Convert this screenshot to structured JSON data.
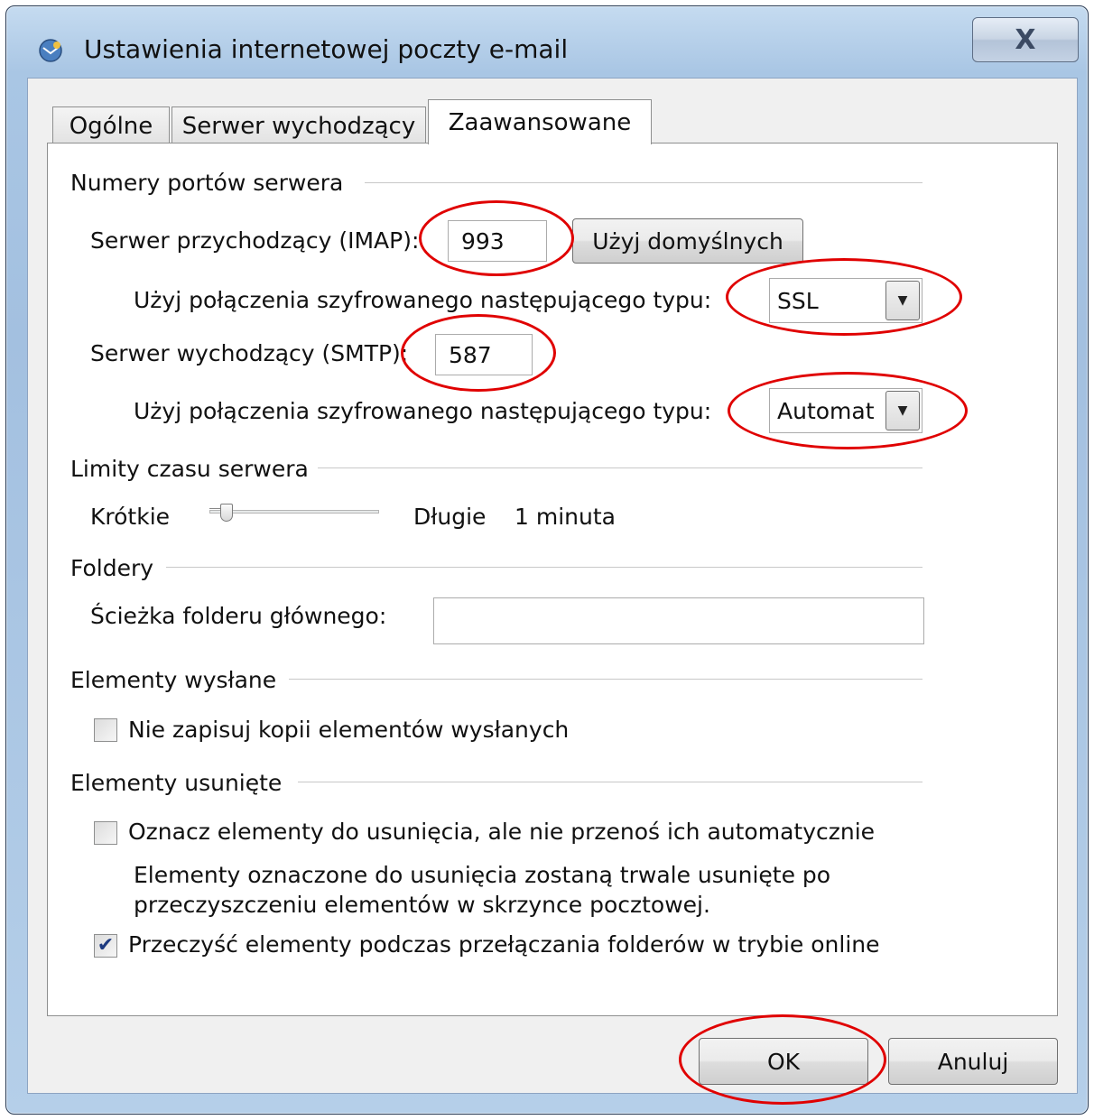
{
  "window": {
    "title": "Ustawienia internetowej poczty e-mail",
    "close_label": "X"
  },
  "tabs": [
    {
      "label": "Ogólne",
      "active": false
    },
    {
      "label": "Serwer wychodzący",
      "active": false
    },
    {
      "label": "Zaawansowane",
      "active": true
    }
  ],
  "ports": {
    "group_label": "Numery portów serwera",
    "imap_label": "Serwer przychodzący (IMAP):",
    "imap_value": "993",
    "defaults_button": "Użyj domyślnych",
    "imap_encryption_label": "Użyj połączenia szyfrowanego następującego typu:",
    "imap_encryption_value": "SSL",
    "smtp_label": "Serwer wychodzący (SMTP):",
    "smtp_value": "587",
    "smtp_encryption_label": "Użyj połączenia szyfrowanego następującego typu:",
    "smtp_encryption_value": "Automat"
  },
  "timeouts": {
    "group_label": "Limity czasu serwera",
    "short_label": "Krótkie",
    "long_label": "Długie",
    "value_label": "1 minuta",
    "slider_level": 0.07
  },
  "folders": {
    "group_label": "Foldery",
    "root_path_label": "Ścieżka folderu głównego:",
    "root_path_value": ""
  },
  "sent_items": {
    "group_label": "Elementy wysłane",
    "dont_save_label": "Nie zapisuj kopii elementów wysłanych",
    "dont_save_checked": false
  },
  "deleted_items": {
    "group_label": "Elementy usunięte",
    "mark_label": "Oznacz elementy do usunięcia, ale nie przenoś ich automatycznie",
    "mark_checked": false,
    "note_line1": "Elementy oznaczone do usunięcia zostaną trwale usunięte po",
    "note_line2": "przeczyszczeniu elementów w skrzynce pocztowej.",
    "purge_label": "Przeczyść elementy podczas przełączania folderów w trybie online",
    "purge_checked": true
  },
  "footer": {
    "ok_label": "OK",
    "cancel_label": "Anuluj"
  },
  "colors": {
    "annotation": "#e00000",
    "title_bar": "#a9c6e4"
  }
}
